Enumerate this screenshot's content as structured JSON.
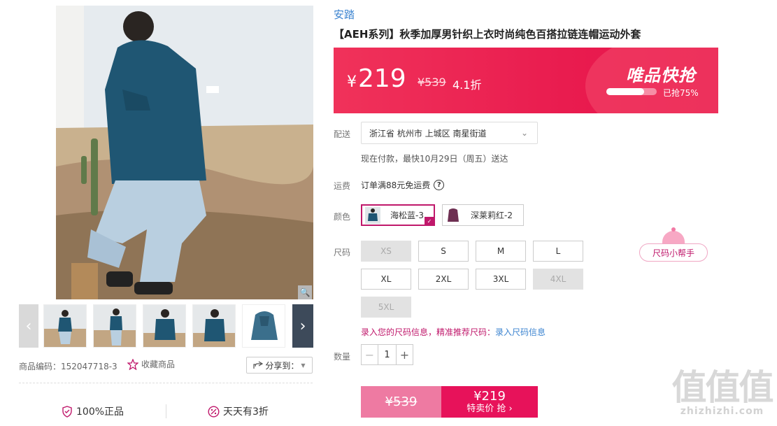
{
  "gallery": {
    "zoom_icon": "magnifier-icon",
    "prev_icon": "chevron-left-icon",
    "next_icon": "chevron-right-icon",
    "thumbnail_count": 5
  },
  "meta": {
    "product_code": "商品编码：152047718-3",
    "favorite_label": "收藏商品",
    "share_label": "分享到："
  },
  "assurances": [
    {
      "icon": "shield-icon",
      "label": "100%正品"
    },
    {
      "icon": "discount-icon",
      "label": "天天有3折"
    }
  ],
  "product": {
    "brand": "安踏",
    "title": "【AEH系列】秋季加厚男针织上衣时尚纯色百搭拉链连帽运动外套"
  },
  "price": {
    "currency": "¥",
    "current": "219",
    "original": "¥539",
    "discount": "4.1折",
    "flash_title": "唯品快抢",
    "sold_progress": 0.75,
    "sold_text": "已抢75%"
  },
  "delivery": {
    "label": "配送",
    "address": "浙江省 杭州市 上城区 南星街道",
    "eta": "现在付款，最快10月29日（周五）送达"
  },
  "shipping_fee": {
    "label": "运费",
    "text": "订单满88元免运费"
  },
  "colors": {
    "label": "颜色",
    "options": [
      {
        "name": "海松蓝-3",
        "selected": true,
        "swatch": "#1f5673"
      },
      {
        "name": "深莱莉红-2",
        "selected": false,
        "swatch": "#6e2f52"
      }
    ]
  },
  "sizes": {
    "label": "尺码",
    "options": [
      {
        "name": "XS",
        "available": false
      },
      {
        "name": "S",
        "available": true
      },
      {
        "name": "M",
        "available": true
      },
      {
        "name": "L",
        "available": true
      },
      {
        "name": "XL",
        "available": true
      },
      {
        "name": "2XL",
        "available": true
      },
      {
        "name": "3XL",
        "available": true
      },
      {
        "name": "4XL",
        "available": false
      },
      {
        "name": "5XL",
        "available": false
      }
    ],
    "helper": "尺码小帮手",
    "tip_text": "录入您的尺码信息，精准推荐尺码：",
    "tip_link": "录入尺码信息"
  },
  "quantity": {
    "label": "数量",
    "value": "1",
    "minus": "−",
    "plus": "+"
  },
  "buy": {
    "original": "¥539",
    "price": "¥219",
    "action": "特卖价 抢 ›"
  },
  "colors_theme": {
    "accent": "#e7125a",
    "brand_link": "#3c84d0",
    "selected_border": "#c0186b"
  },
  "watermark": {
    "glyphs": "值值值",
    "url": "zhizhizhi.com"
  }
}
